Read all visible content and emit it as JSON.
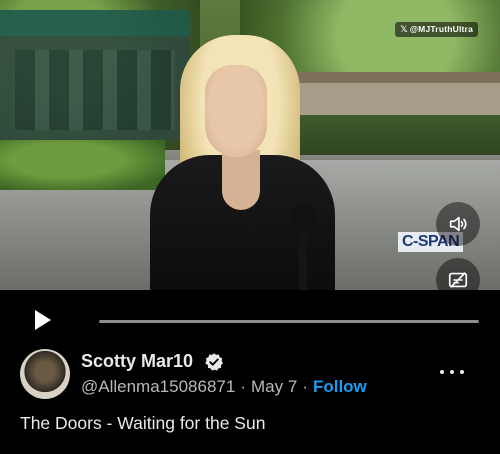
{
  "video": {
    "watermark": "@MJTruthUltra",
    "watermark_icon": "x-logo",
    "broadcaster": "C-SPAN",
    "progress_percent": 0
  },
  "controls": {
    "play_icon": "play-icon",
    "mute_icon": "speaker-icon",
    "captions_icon": "captions-off-icon"
  },
  "author": {
    "display_name": "Scotty Mar10",
    "handle": "@Allenma15086871",
    "date": "May 7",
    "follow_label": "Follow",
    "verified": true
  },
  "tweet": {
    "text": "The Doors - Waiting for the Sun"
  },
  "colors": {
    "background": "#000000",
    "accent": "#1d9bf0",
    "text": "#e7e9ea",
    "secondary_text": "#b6b9bc"
  }
}
